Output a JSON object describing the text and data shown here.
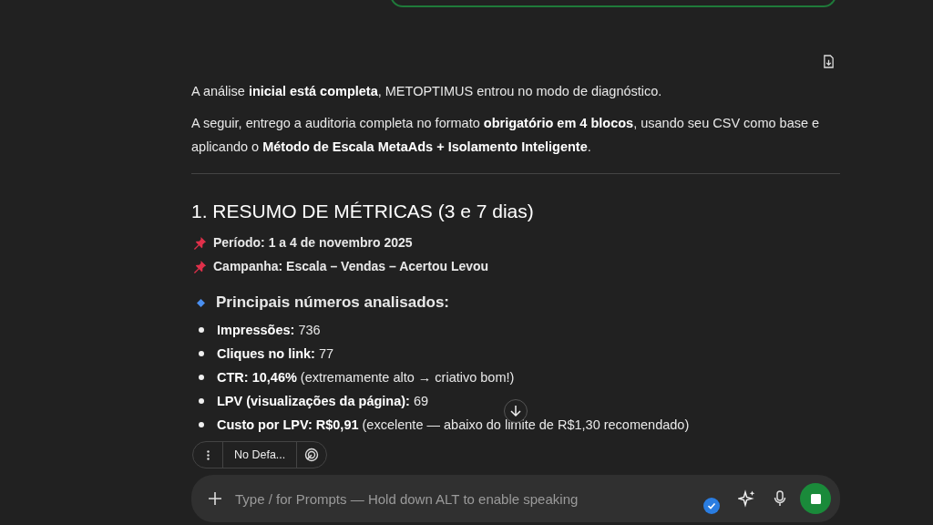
{
  "response": {
    "paragraphs": [
      "A análise **inicial está completa**, METOPTIMUS entrou no modo de diagnóstico.",
      "A seguir, entrego a auditoria completa no formato **obrigatório em 4 blocos**, usando seu CSV como base e aplicando o **Método de Escala MetaAds + Isolamento Inteligente**."
    ],
    "heading": "1. RESUMO DE MÉTRICAS (3 e 7 dias)",
    "pinned": [
      "Período: 1 a 4 de novembro 2025",
      "Campanha: Escala – Vendas – Acertou Levou"
    ],
    "subheading": "Principais números analisados:",
    "bullets": [
      "**Impressões:** 736",
      "**Cliques no link:** 77",
      "**CTR: 10,46%** (extremamente alto → criativo bom!)",
      "**LPV (visualizações da página):** 69",
      "**Custo por LPV: R$0,91** (excelente — abaixo do limite de R$1,30 recomendado)"
    ]
  },
  "toolbar": {
    "model": "No Defa..."
  },
  "composer": {
    "placeholder": "Type / for Prompts — Hold down ALT to enable speaking"
  }
}
